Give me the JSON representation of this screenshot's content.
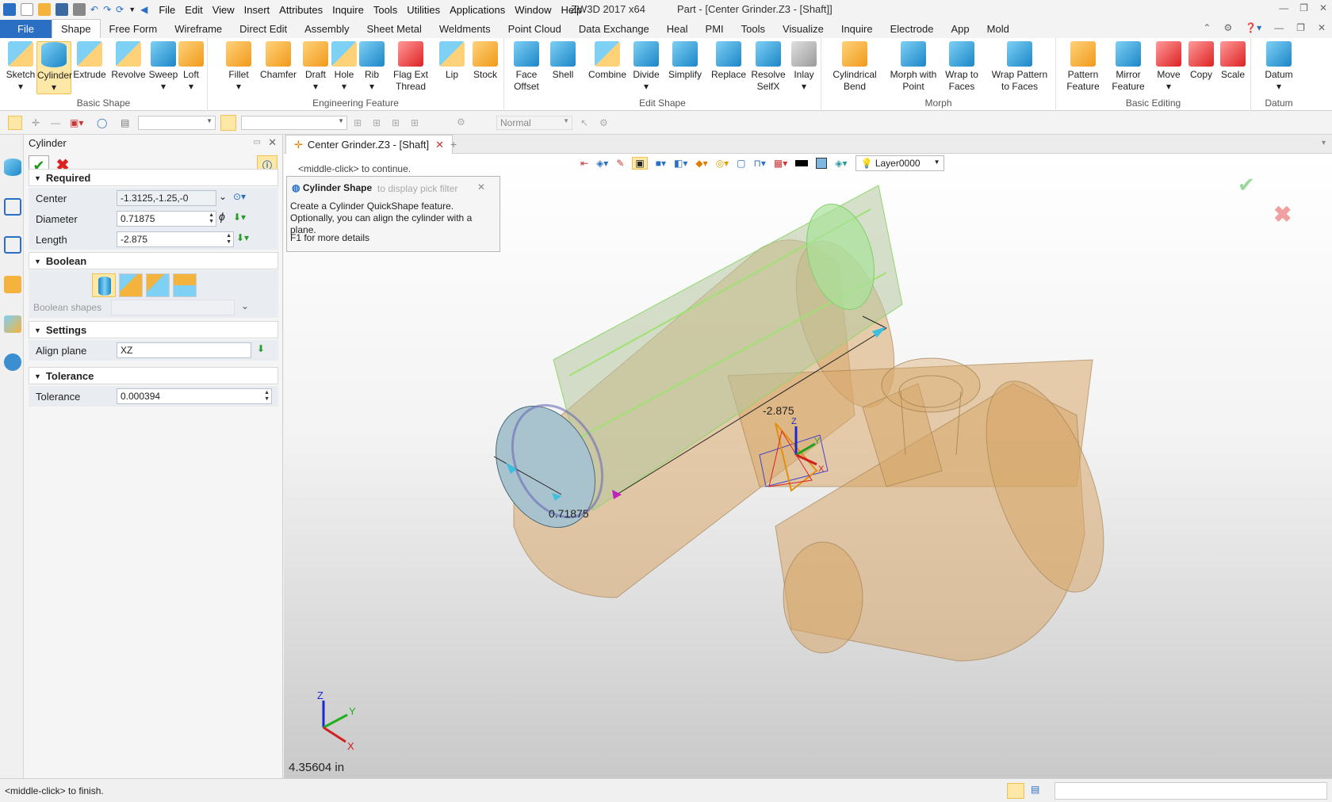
{
  "app": {
    "menu": [
      "File",
      "Edit",
      "View",
      "Insert",
      "Attributes",
      "Inquire",
      "Tools",
      "Utilities",
      "Applications",
      "Window",
      "Help"
    ],
    "product": "ZW3D 2017  x64",
    "title": "Part - [Center Grinder.Z3 - [Shaft]]"
  },
  "tabs": [
    "File",
    "Shape",
    "Free Form",
    "Wireframe",
    "Direct Edit",
    "Assembly",
    "Sheet Metal",
    "Weldments",
    "Point Cloud",
    "Data Exchange",
    "Heal",
    "PMI",
    "Tools",
    "Visualize",
    "Inquire",
    "Electrode",
    "App",
    "Mold"
  ],
  "active_tab": "Shape",
  "ribbon": {
    "basic_shape": {
      "label": "Basic Shape",
      "items": [
        "Sketch",
        "Cylinder",
        "Extrude",
        "Revolve",
        "Sweep",
        "Loft"
      ]
    },
    "engineering_feature": {
      "label": "Engineering Feature",
      "items": [
        "Fillet",
        "Chamfer",
        "Draft",
        "Hole",
        "Rib",
        "Flag Ext Thread",
        "Lip",
        "Stock"
      ]
    },
    "edit_shape": {
      "label": "Edit Shape",
      "items": [
        "Face Offset",
        "Shell",
        "Combine",
        "Divide",
        "Simplify",
        "Replace",
        "Resolve SelfX",
        "Inlay"
      ]
    },
    "morph": {
      "label": "Morph",
      "items": [
        "Cylindrical Bend",
        "Morph with Point",
        "Wrap to Faces",
        "Wrap Pattern to Faces"
      ]
    },
    "basic_editing": {
      "label": "Basic Editing",
      "items": [
        "Pattern Feature",
        "Mirror Feature",
        "Move",
        "Copy",
        "Scale"
      ]
    },
    "datum": {
      "label": "Datum",
      "items": [
        "Datum"
      ]
    }
  },
  "toolbar2": {
    "render_mode": "Normal"
  },
  "panel": {
    "title": "Cylinder",
    "required": {
      "label": "Required",
      "center_label": "Center",
      "center": "-1.3125,-1.25,-0",
      "diameter_label": "Diameter",
      "diameter": "0.71875",
      "length_label": "Length",
      "length": "-2.875"
    },
    "boolean": {
      "label": "Boolean",
      "shapes_label": "Boolean shapes"
    },
    "settings": {
      "label": "Settings",
      "align_plane_label": "Align plane",
      "align_plane": "XZ"
    },
    "tolerance": {
      "label": "Tolerance",
      "tolerance_label": "Tolerance",
      "tolerance": "0.000394"
    }
  },
  "document": {
    "tab": "Center Grinder.Z3 - [Shaft]"
  },
  "viewport": {
    "layer": "Layer0000",
    "hint1": "<middle-click> to continue.",
    "hint2": "to display pick filter",
    "tip_title": "Cylinder Shape",
    "tip_body": "Create a Cylinder QuickShape feature.  Optionally, you can align the cylinder with a plane.",
    "tip_help": "F1 for more details",
    "dim_length": "-2.875",
    "dim_diameter": "0.71875",
    "measure": "4.35604 in",
    "axes": {
      "x": "X",
      "y": "Y",
      "z": "Z"
    }
  },
  "status": {
    "text": "<middle-click> to finish."
  }
}
